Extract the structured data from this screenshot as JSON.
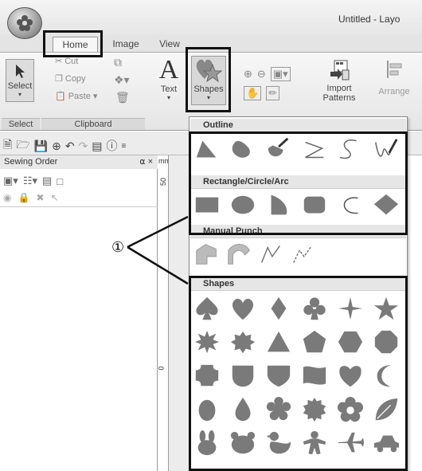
{
  "window": {
    "title": "Untitled - Layo"
  },
  "tabs": {
    "home": "Home",
    "image": "Image",
    "view": "View"
  },
  "ribbon": {
    "select_label": "Select",
    "cut": "Cut",
    "copy": "Copy",
    "paste": "Paste",
    "text_label": "Text",
    "shapes_label": "Shapes",
    "import_label_1": "Import",
    "import_label_2": "Patterns",
    "arrange_label": "Arrange",
    "group_select": "Select",
    "group_clipboard": "Clipboard"
  },
  "sewing_panel": {
    "title": "Sewing Order",
    "pin": " ×"
  },
  "ruler": {
    "unit": "mm",
    "tick_top": "50",
    "tick_mid": "0"
  },
  "dropdown": {
    "sections": {
      "outline": "Outline",
      "rect_circle_arc": "Rectangle/Circle/Arc",
      "manual_punch": "Manual Punch",
      "shapes": "Shapes"
    }
  },
  "callout": {
    "number": "①"
  },
  "colors": {
    "shape_fill": "#7a7a7a",
    "callout_border": "#111111",
    "dropdown_border": "#888888"
  },
  "icons": {
    "outline": [
      "polygon-icon",
      "blob-icon",
      "brush-icon",
      "zigzag-line-icon",
      "s-curve-icon",
      "freehand-icon"
    ],
    "rect_circle_arc": [
      "rectangle-icon",
      "ellipse-icon",
      "fan-icon",
      "rounded-rectangle-icon",
      "arc-icon",
      "rhombus-icon"
    ],
    "manual_punch": [
      "punch-block-icon",
      "punch-arc-icon",
      "punch-zigzag-icon",
      "punch-dashed-icon"
    ],
    "shapes": [
      "spade-icon",
      "heart-icon",
      "diamond-icon",
      "club-icon",
      "four-point-star-icon",
      "star-icon",
      "eight-point-star-icon",
      "burst-icon",
      "triangle-icon",
      "pentagon-icon",
      "hexagon-icon",
      "octagon-icon",
      "notched-square-icon",
      "u-shield-icon",
      "shield-icon",
      "flag-icon",
      "heart-shield-icon",
      "crescent-icon",
      "egg-icon",
      "drop-icon",
      "cloud-icon",
      "seal-icon",
      "flower-icon",
      "leaf-icon",
      "rabbit-icon",
      "bear-icon",
      "duck-icon",
      "gingerbread-icon",
      "airplane-icon",
      "car-icon"
    ]
  }
}
